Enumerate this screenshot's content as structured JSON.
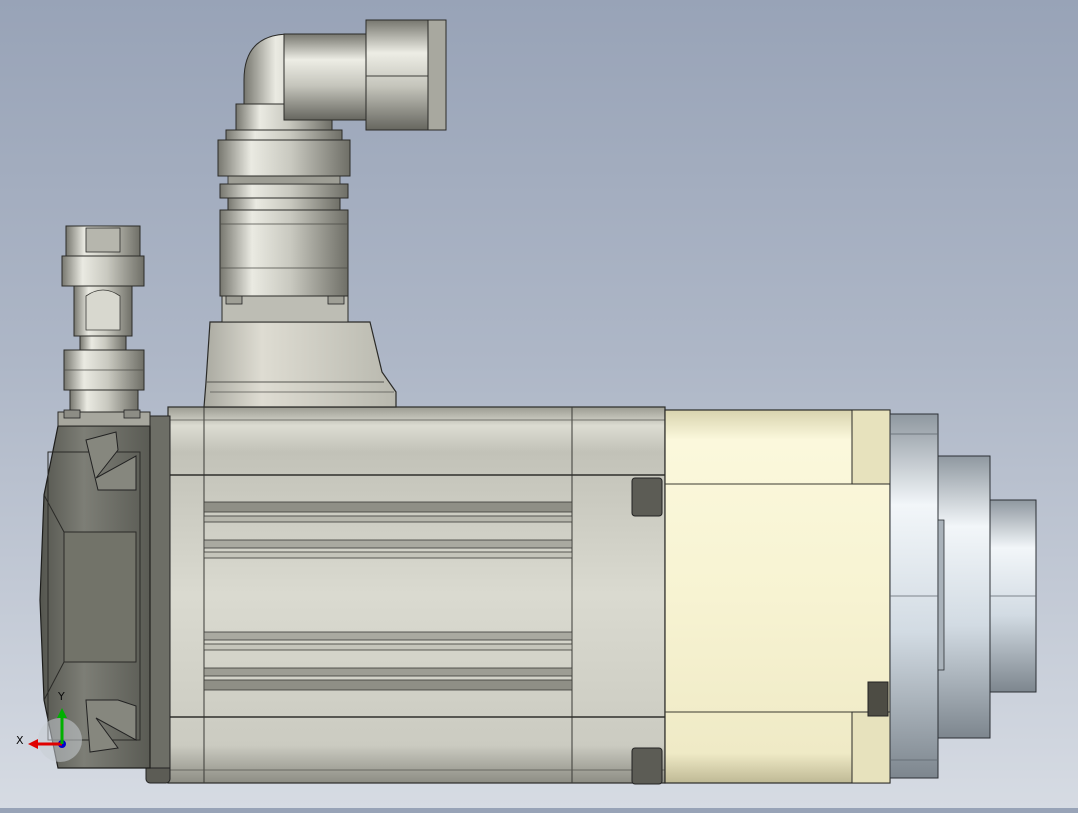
{
  "viewport": {
    "background_top": "#98a3b7",
    "background_bottom": "#d6dbe3",
    "model": {
      "housing_color": "#d5d5ca",
      "flange_color": "#f3efcb",
      "connector_color": "#c9c9c0",
      "encoder_cap_color": "#6e6f67",
      "shaft_color": "#dde6ee"
    }
  },
  "triad": {
    "x_label": "X",
    "y_label": "Y",
    "x_color": "#e00000",
    "y_color": "#00b000",
    "z_color": "#0000d0"
  }
}
